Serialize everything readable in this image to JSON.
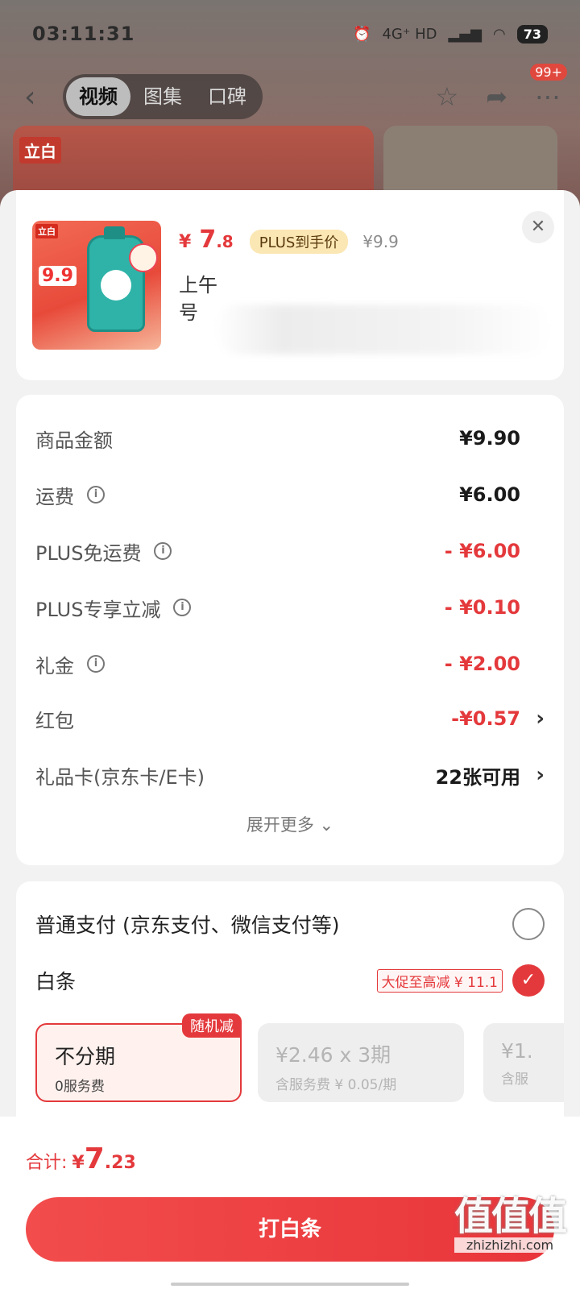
{
  "status": {
    "time": "03:11:31",
    "network": "4G⁺ HD",
    "battery": "73"
  },
  "nav": {
    "tabs": [
      {
        "label": "视频"
      },
      {
        "label": "图集"
      },
      {
        "label": "口碑"
      }
    ],
    "badge": "99+"
  },
  "banner": {
    "brand": "立白"
  },
  "product": {
    "thumb_brand": "立白",
    "thumb_price": "9.9",
    "currency": "¥",
    "price_int": "7",
    "price_dec": ".8",
    "plus_tag": "PLUS到手价",
    "orig_price": "¥9.9",
    "name_line1": "上午",
    "name_line2": "号"
  },
  "fees": {
    "rows": [
      {
        "label": "商品金额",
        "amount": "¥9.90"
      },
      {
        "label": "运费",
        "amount": "¥6.00"
      },
      {
        "label": "PLUS免运费",
        "amount": "- ¥6.00"
      },
      {
        "label": "PLUS专享立减",
        "amount": "- ¥0.10"
      },
      {
        "label": "礼金",
        "amount": "- ¥2.00"
      },
      {
        "label": "红包",
        "amount": "-¥0.57"
      },
      {
        "label": "礼品卡(京东卡/E卡)",
        "amount": "22张可用"
      }
    ],
    "expand": "展开更多 ⌄"
  },
  "payment": {
    "normal_label": "普通支付 (京东支付、微信支付等)",
    "baitiao_label": "白条",
    "promo": "大促至高减 ¥ 11.1",
    "plans": [
      {
        "title": "不分期",
        "sub": "0服务费",
        "tag": "随机减"
      },
      {
        "title": "¥2.46 x 3期",
        "sub": "含服务费 ¥ 0.05/期"
      },
      {
        "title": "¥1.",
        "sub": "含服"
      }
    ]
  },
  "footer": {
    "total_label": "合计:",
    "currency": "¥",
    "total_int": "7",
    "total_dec": ".23",
    "pay_button": "打白条"
  },
  "watermark": {
    "text": "值值值",
    "url": "zhizhizhi.com"
  },
  "colors": {
    "accent": "#e4393c",
    "plus_tag_bg": "#fbe7b3"
  }
}
